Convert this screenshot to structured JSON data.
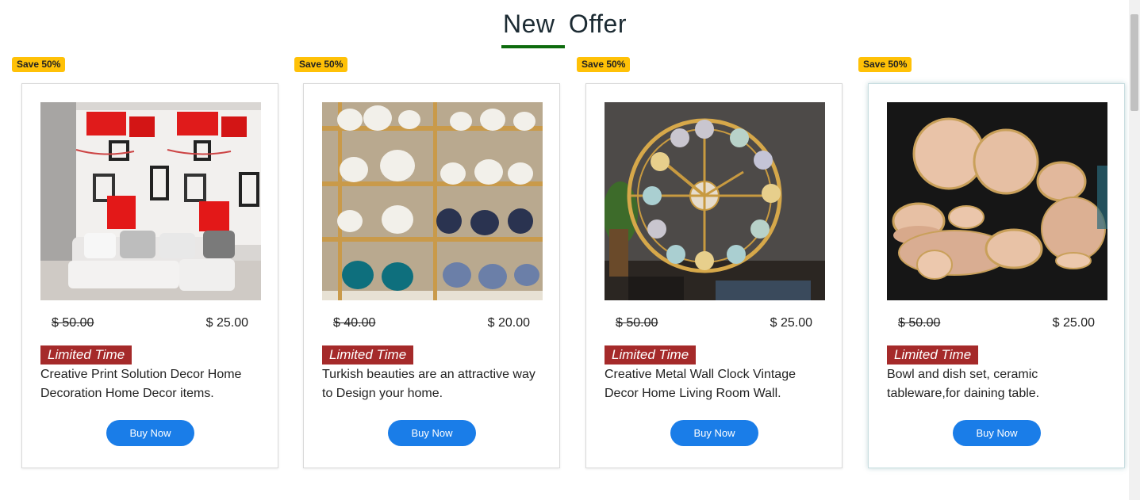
{
  "section": {
    "title_word1": "New",
    "title_word2": "Offer",
    "underline_color": "#0d6b0d"
  },
  "products": [
    {
      "badge": "Save 50%",
      "image_icon": "living-room-wallpaper-image",
      "old_price": "$ 50.00",
      "new_price": "$ 25.00",
      "tag": "Limited Time",
      "description": "Creative Print Solution Decor Home Decoration Home Decor items.",
      "button": "Buy Now"
    },
    {
      "badge": "Save 50%",
      "image_icon": "ceramic-jars-shelves-image",
      "old_price": "$ 40.00",
      "new_price": "$ 20.00",
      "tag": "Limited Time",
      "description": "Turkish beauties are an attractive way to Design your home.",
      "button": "Buy Now"
    },
    {
      "badge": "Save 50%",
      "image_icon": "metal-wall-clock-image",
      "old_price": "$ 50.00",
      "new_price": "$ 25.00",
      "tag": "Limited Time",
      "description": "Creative Metal Wall Clock Vintage Decor Home Living Room Wall.",
      "button": "Buy Now"
    },
    {
      "badge": "Save 50%",
      "image_icon": "ceramic-dish-set-image",
      "old_price": "$ 50.00",
      "new_price": "$ 25.00",
      "tag": "Limited Time",
      "description": "Bowl and dish set, ceramic tableware,for daining table.",
      "button": "Buy Now"
    }
  ],
  "colors": {
    "badge": "#ffc107",
    "tag": "#a52a2a",
    "button": "#1a7de8"
  }
}
